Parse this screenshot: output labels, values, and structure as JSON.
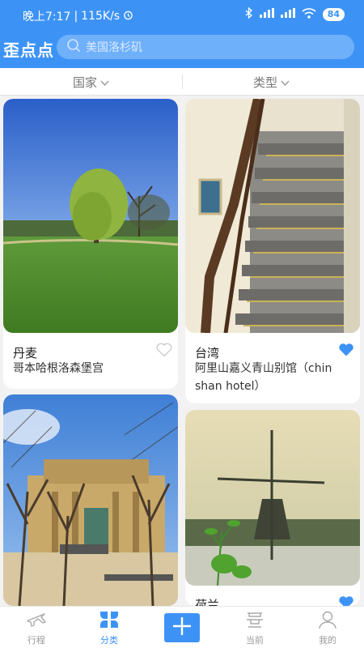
{
  "status_bar": {
    "time": "晚上7:17",
    "speed": "115K/s",
    "battery": "84"
  },
  "header": {
    "title": "歪点点",
    "search_placeholder": "美国洛杉矶"
  },
  "filters": {
    "country": "国家",
    "type": "类型"
  },
  "cards": [
    {
      "country": "丹麦",
      "place": "哥本哈根洛森堡宫",
      "favorited": false
    },
    {
      "country": "台湾",
      "place_line1": "阿里山嘉义青山别馆（chin",
      "place_line2": "shan hotel）",
      "favorited": true
    },
    {
      "country": "",
      "place": "",
      "favorited": false
    },
    {
      "country": "荷兰",
      "place": "",
      "favorited": true
    }
  ],
  "tabs": [
    {
      "label": "行程",
      "icon": "plane-icon",
      "active": false
    },
    {
      "label": "分类",
      "icon": "category-icon",
      "active": true
    },
    {
      "label": "",
      "icon": "add-icon",
      "active": false
    },
    {
      "label": "当前",
      "icon": "location-icon",
      "active": false
    },
    {
      "label": "我的",
      "icon": "user-icon",
      "active": false
    }
  ],
  "colors": {
    "brand_blue": "#3d93f5",
    "heart_active": "#3d93f5",
    "heart_inactive": "#cfcfcf"
  }
}
